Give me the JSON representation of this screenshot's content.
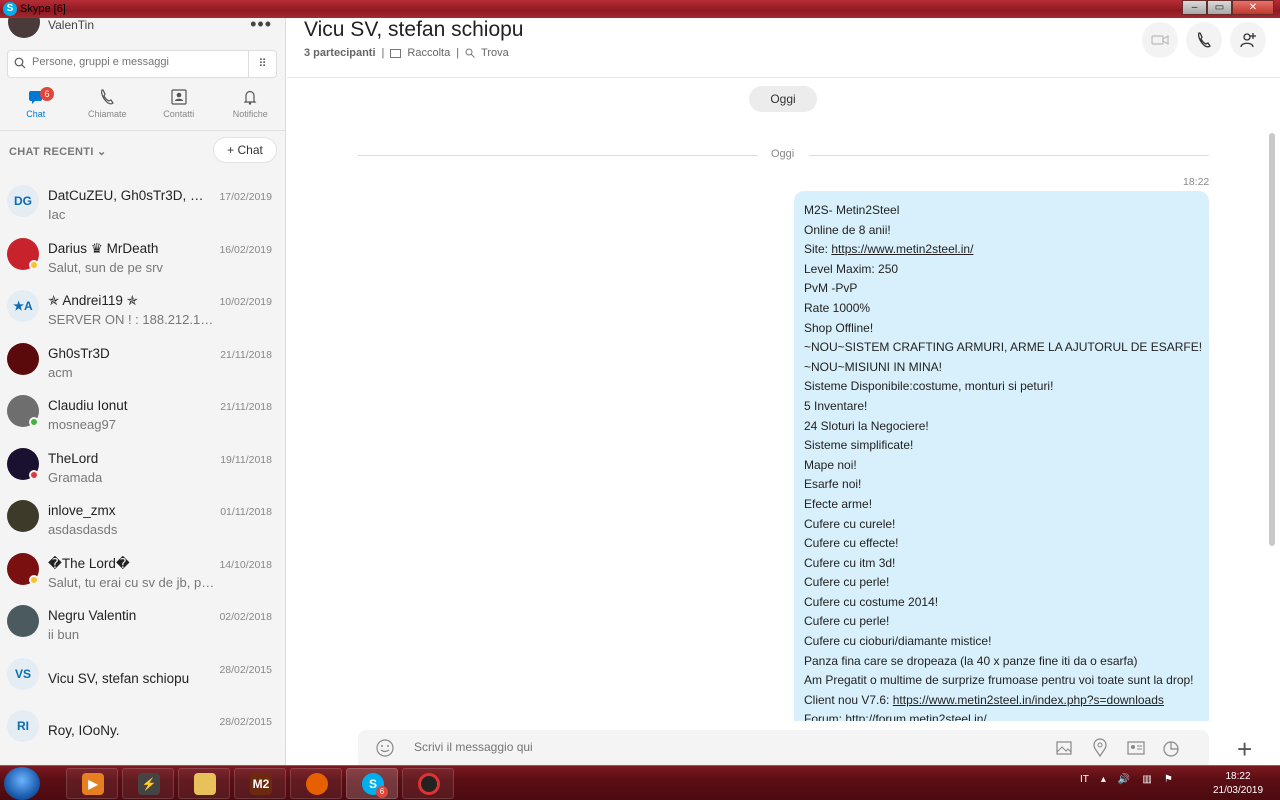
{
  "window": {
    "title": "Skype [6]",
    "app_icon": "S",
    "btn_min": "‒",
    "btn_max": "▭",
    "btn_close": "✕"
  },
  "profile": {
    "name": "ValenTin",
    "more": "•••"
  },
  "search": {
    "placeholder": "Persone, gruppi e messaggi",
    "dialpad": "⠿"
  },
  "nav": {
    "chat": "Chat",
    "chat_badge": "6",
    "calls": "Chiamate",
    "contacts": "Contatti",
    "notifications": "Notifiche"
  },
  "recent": {
    "header": "CHAT RECENTI ⌄",
    "new_chat": "+ Chat"
  },
  "chats": [
    {
      "initials": "DG",
      "name": "DatCuZEU, Gh0sTr3D, 2 a...",
      "preview": "Iac",
      "date": "17/02/2019",
      "avatar_color": "#e4ecf4",
      "status": ""
    },
    {
      "initials": "",
      "name": "Darius ♛ MrDeath",
      "preview": "Salut, sun de pe srv",
      "date": "16/02/2019",
      "avatar_color": "#c8232c",
      "status": "#f7c32e"
    },
    {
      "initials": "★A",
      "name": "✯ Andrei119 ✯",
      "preview": "SERVER ON ! : 188.212.100....",
      "date": "10/02/2019",
      "avatar_color": "#e4ecf4",
      "status": ""
    },
    {
      "initials": "",
      "name": "Gh0sTr3D",
      "preview": "acm",
      "date": "21/11/2018",
      "avatar_color": "#5a0a0a",
      "status": ""
    },
    {
      "initials": "",
      "name": "Claudiu Ionut",
      "preview": "mosneag97",
      "date": "21/11/2018",
      "avatar_color": "#6e6e6e",
      "status": "#3fb43b"
    },
    {
      "initials": "",
      "name": "TheLord",
      "preview": "Gramada",
      "date": "19/11/2018",
      "avatar_color": "#1a1030",
      "status": "#d93a3a"
    },
    {
      "initials": "",
      "name": "inlove_zmx",
      "preview": "asdasdasds",
      "date": "01/11/2018",
      "avatar_color": "#3d3a2a",
      "status": ""
    },
    {
      "initials": "",
      "name": "�The Lord�",
      "preview": "Salut, tu erai cu sv de jb, pa...",
      "date": "14/10/2018",
      "avatar_color": "#7a1010",
      "status": "#f7c32e"
    },
    {
      "initials": "",
      "name": "Negru Valentin",
      "preview": "ii bun",
      "date": "02/02/2018",
      "avatar_color": "#4b5a5e",
      "status": ""
    },
    {
      "initials": "VS",
      "name": "Vicu SV, stefan schiopu",
      "preview": "",
      "date": "28/02/2015",
      "avatar_color": "#e4ecf4",
      "status": ""
    },
    {
      "initials": "RI",
      "name": "Roy, IOoNy.",
      "preview": "",
      "date": "28/02/2015",
      "avatar_color": "#e4ecf4",
      "status": ""
    }
  ],
  "conversation": {
    "title": "Vicu SV, stefan schiopu",
    "participants": "3 partecipanti",
    "sep1": "|",
    "gallery": "Raccolta",
    "sep2": "|",
    "find": "Trova",
    "day_pill": "Oggi",
    "day_divider": "Oggi",
    "time": "18:22",
    "message_lines": [
      "M2S- Metin2Steel",
      "Online de 8 anii!",
      "Site: |https://www.metin2steel.in/",
      "Level Maxim: 250",
      "PvM -PvP",
      "Rate 1000%",
      "Shop Offline!",
      "~NOU~SISTEM CRAFTING ARMURI, ARME LA AJUTORUL DE ESARFE!",
      "~NOU~MISIUNI IN MINA!",
      "Sisteme Disponibile:costume, monturi si peturi!",
      "5 Inventare!",
      "24 Sloturi la Negociere!",
      "Sisteme simplificate!",
      "Mape noi!",
      "Esarfe noi!",
      "Efecte arme!",
      "Cufere cu curele!",
      "Cufere cu effecte!",
      "Cufere cu itm 3d!",
      "Cufere cu perle!",
      "Cufere cu costume 2014!",
      "Cufere cu perle!",
      "Cufere cu cioburi/diamante mistice!",
      "Panza fina care se dropeaza (la 40 x panze fine iti da o esarfa)",
      "Am Pregatit o multime de surprize frumoase pentru voi toate sunt la drop!",
      "Client nou V7.6: |https://www.metin2steel.in/index.php?s=downloads",
      "Forum: http://forum.metin2steel.in/"
    ],
    "composer_placeholder": "Scrivi il messaggio qui",
    "add": "+"
  },
  "taskbar": {
    "skype_badge": "6",
    "m2_label": "M2",
    "lang": "IT",
    "time": "18:22",
    "date": "21/03/2019"
  },
  "colors": {
    "accent": "#0078d4",
    "bubble": "#d8f0fb",
    "badge": "#e0463a",
    "titlebar": "#a32a30"
  }
}
